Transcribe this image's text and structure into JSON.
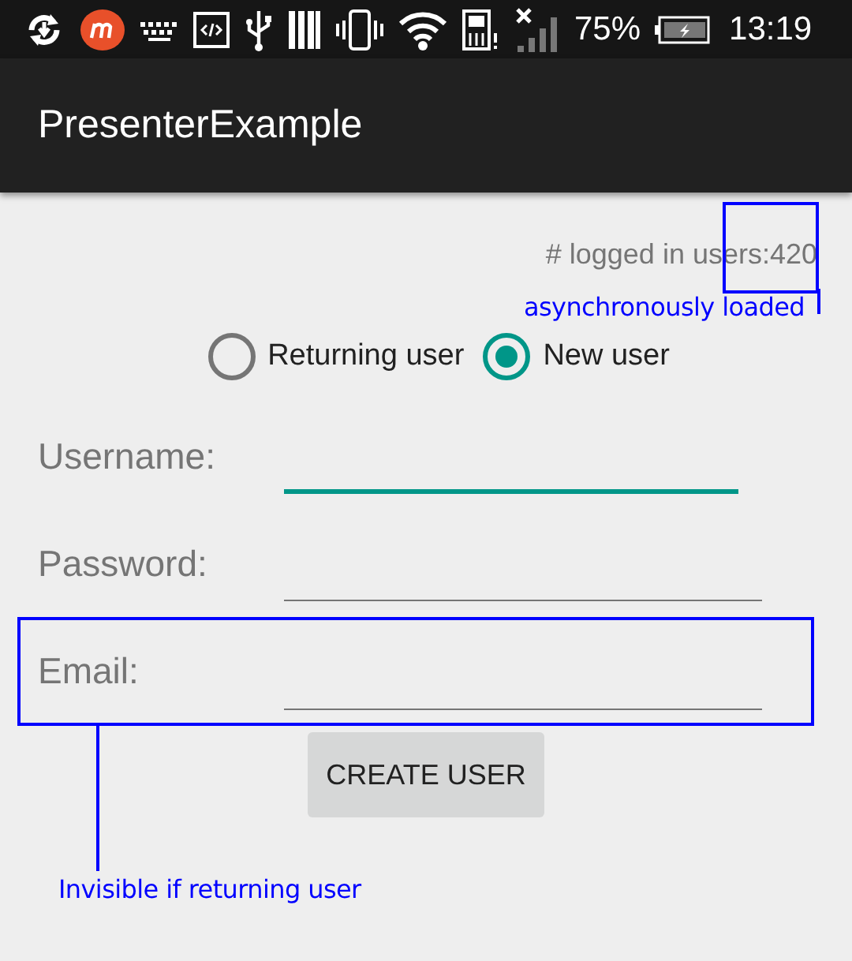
{
  "status_bar": {
    "battery": "75%",
    "time": "13:19"
  },
  "app_bar": {
    "title": "PresenterExample"
  },
  "logged_in_users": {
    "text": "# logged in users:420",
    "note": "asynchronously loaded"
  },
  "user_type": [
    {
      "label": "Returning user",
      "selected": false
    },
    {
      "label": "New user",
      "selected": true
    }
  ],
  "fields": [
    {
      "label": "Username:",
      "focused": true
    },
    {
      "label": "Password:",
      "focused": false
    },
    {
      "label": "Email:",
      "focused": false,
      "note": "Invisible if returning user"
    }
  ],
  "button": "CREATE USER"
}
